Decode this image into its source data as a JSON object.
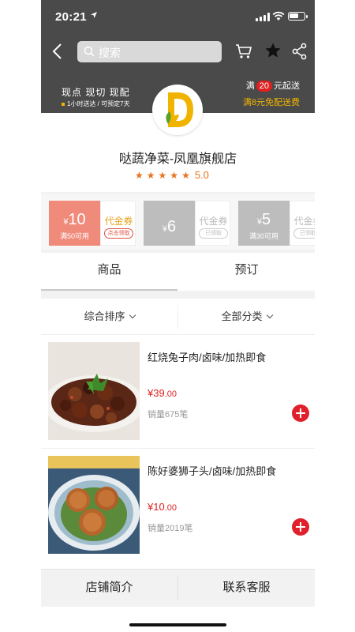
{
  "status_bar": {
    "time": "20:21"
  },
  "header": {
    "search_placeholder": "搜索",
    "slogan": "现点 现切 现配",
    "subslogan": "1小时送达 / 可预定7天",
    "min_fee_prefix": "满",
    "min_fee_amount": "20",
    "min_fee_suffix": "元起送",
    "free_shipping": "满8元免配送费"
  },
  "shop": {
    "name": "哒蔬净菜-凤凰旗舰店",
    "rating": "5.0",
    "rating_stars": 5
  },
  "coupons": [
    {
      "currency": "¥",
      "amount": "10",
      "condition": "满50可用",
      "type": "代金券",
      "action": "点击领取",
      "state": "active"
    },
    {
      "currency": "¥",
      "amount": "6",
      "condition": "",
      "type": "代金券",
      "action": "已领取",
      "state": "used"
    },
    {
      "currency": "¥",
      "amount": "5",
      "condition": "满30可用",
      "type": "代金券",
      "action": "已领取",
      "state": "used"
    }
  ],
  "tabs": [
    {
      "label": "商品"
    },
    {
      "label": "预订"
    }
  ],
  "filters": [
    {
      "label": "综合排序"
    },
    {
      "label": "全部分类"
    }
  ],
  "products": [
    {
      "name": "红烧兔子肉/卤味/加热即食",
      "price_yuan": "¥39",
      "price_cents": ".00",
      "sales": "销量675笔"
    },
    {
      "name": "陈好婆狮子头/卤味/加热即食",
      "price_yuan": "¥10",
      "price_cents": ".00",
      "sales": "销量2019笔"
    }
  ],
  "bottom_bar": {
    "intro": "店铺简介",
    "contact": "联系客服"
  },
  "colors": {
    "header_bg": "#4a4a4a",
    "accent_red": "#e0202a",
    "rating_orange": "#e8731e",
    "logo_yellow": "#f0b400",
    "logo_green": "#5aa02c"
  },
  "icons": [
    "location-arrow-icon",
    "signal-icon",
    "wifi-icon",
    "battery-icon",
    "back-icon",
    "search-icon",
    "cart-icon",
    "star-icon",
    "share-icon",
    "chevron-down-icon",
    "add-icon"
  ]
}
